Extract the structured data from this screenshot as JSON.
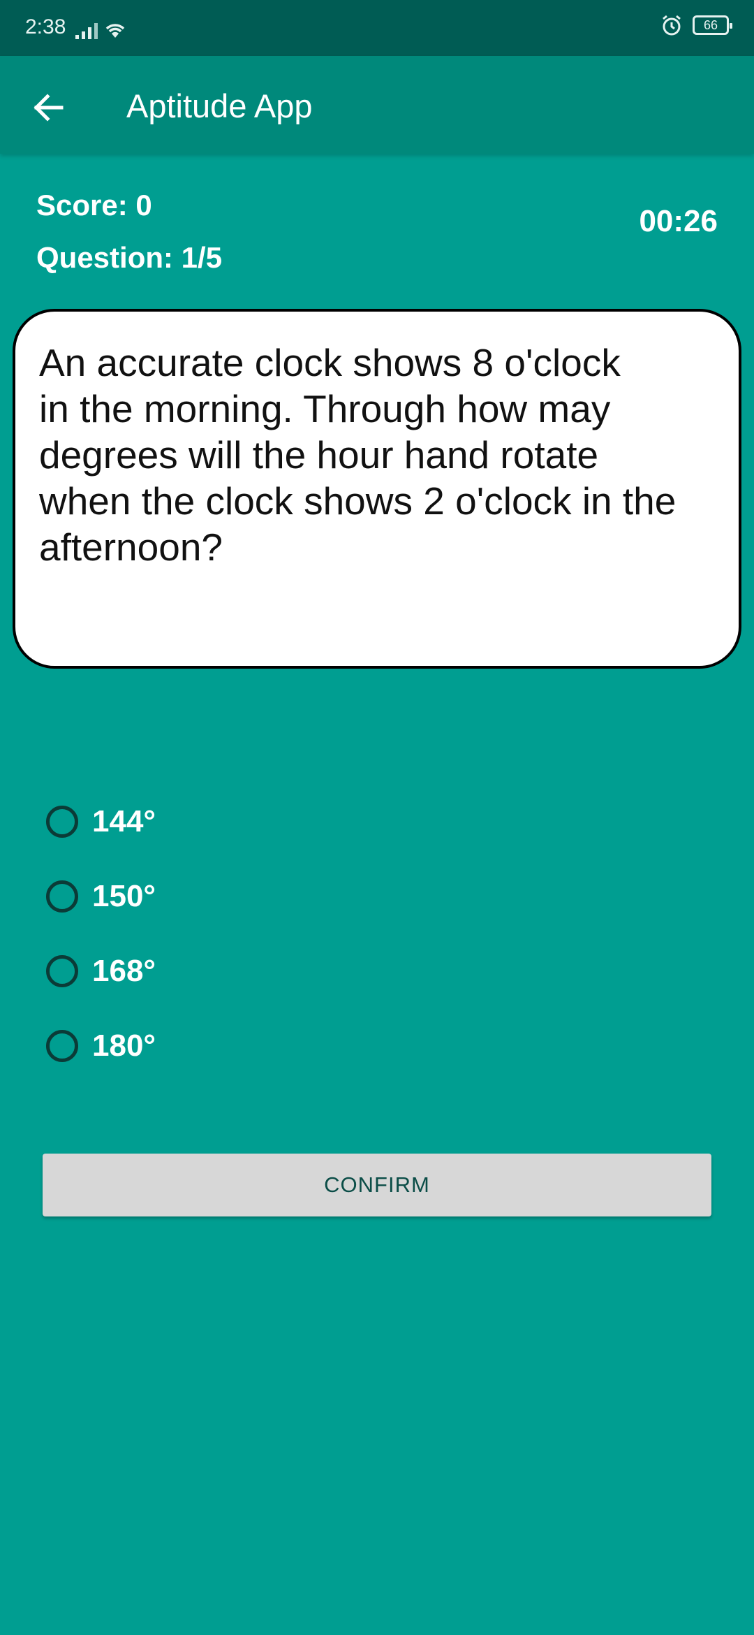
{
  "status_bar": {
    "time": "2:38",
    "battery": "66",
    "icons": [
      "signal-icon",
      "wifi-icon",
      "alarm-icon",
      "battery-icon"
    ]
  },
  "app_bar": {
    "title": "Aptitude App",
    "back_icon": "arrow-back-icon"
  },
  "quiz": {
    "score": "Score: 0",
    "question_counter": "Question: 1/5",
    "timer": "00:26",
    "question": "An accurate clock shows 8 o'clock\nin the morning. Through how may\ndegrees will the hour hand rotate\nwhen the clock shows 2 o'clock in the\nafternoon?",
    "options": [
      "144°",
      "150°",
      "168°",
      "180°"
    ],
    "confirm_label": "CONFIRM"
  },
  "colors": {
    "background": "#009E91",
    "app_bar": "#00897B",
    "status_bar": "#005C54",
    "button": "#D7D7D7"
  }
}
